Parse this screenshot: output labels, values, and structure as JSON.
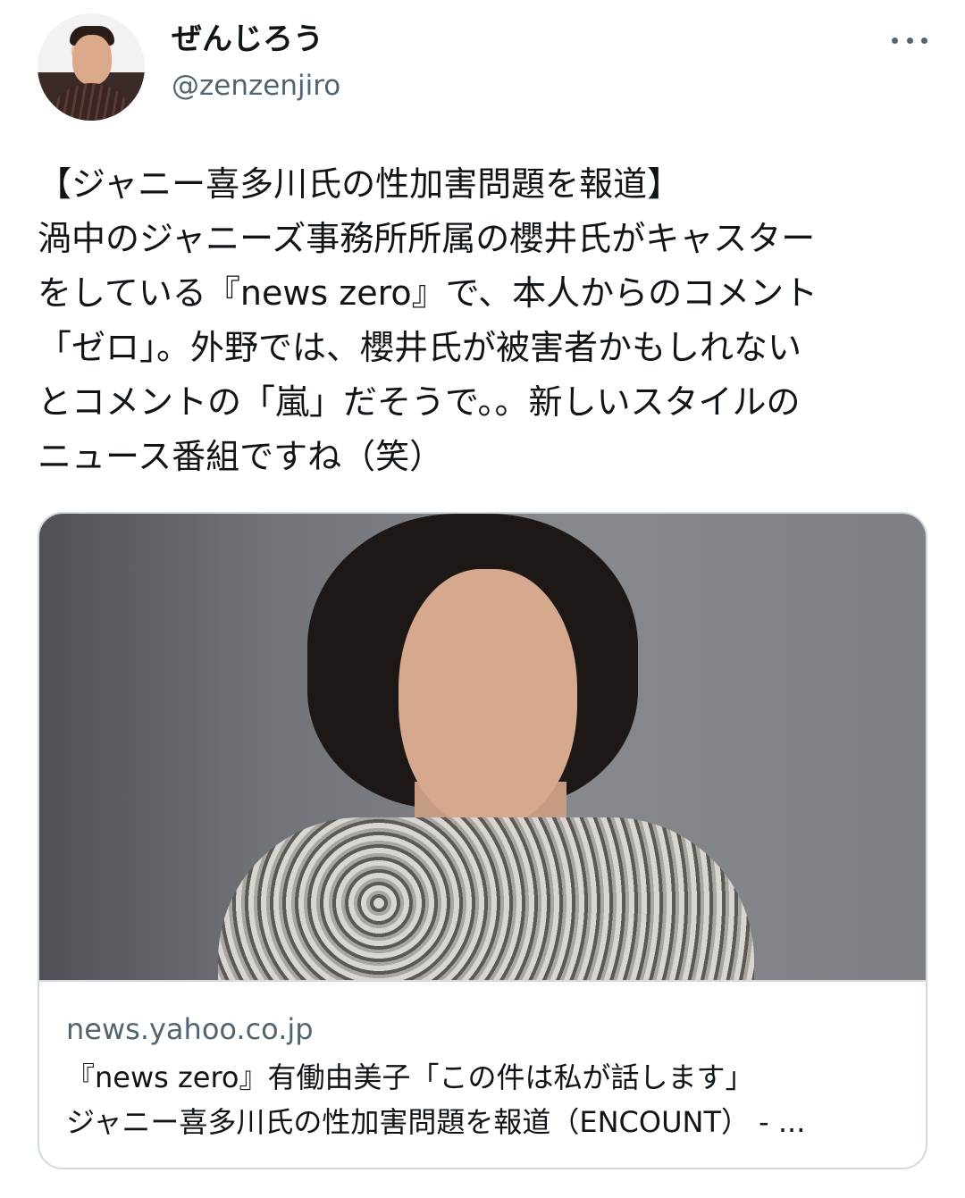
{
  "tweet": {
    "display_name": "ぜんじろう",
    "handle": "@zenzenjiro",
    "text_lines": [
      "【ジャニー喜多川氏の性加害問題を報道】",
      "渦中のジャニーズ事務所所属の櫻井氏がキャスター",
      "をしている『news zero』で、本人からのコメント",
      "「ゼロ」。外野では、櫻井氏が被害者かもしれない",
      "とコメントの「嵐」だそうで。。新しいスタイルの",
      "ニュース番組ですね（笑）"
    ]
  },
  "card": {
    "domain": "news.yahoo.co.jp",
    "title_line_1": "『news zero』有働由美子「この件は私が話します」",
    "title_line_2": "ジャニー喜多川氏の性加害問題を報道（ENCOUNT） - ..."
  },
  "icons": {
    "more": "more-horizontal-icon"
  }
}
